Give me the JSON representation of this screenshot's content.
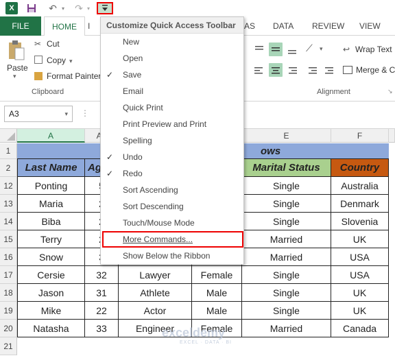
{
  "qat": {
    "excel_logo": "X",
    "undo_icon": "↶",
    "redo_icon": "↷",
    "dropdown_icon": "▾"
  },
  "tabs": {
    "file": "FILE",
    "home": "HOME",
    "i_frag": "I",
    "as_frag": "AS",
    "data": "DATA",
    "review": "REVIEW",
    "view": "VIEW"
  },
  "ribbon": {
    "paste": "Paste",
    "cut": "Cut",
    "copy": "Copy",
    "format_painter": "Format Painter",
    "clipboard": "Clipboard",
    "wrap_text": "Wrap Text",
    "merge": "Merge & C",
    "alignment": "Alignment"
  },
  "formula": {
    "namebox": "A3",
    "dots": "⋮"
  },
  "columns": [
    "A",
    "Ag",
    "",
    "",
    "E",
    "F"
  ],
  "rows": [
    "1",
    "2",
    "12",
    "13",
    "14",
    "15",
    "16",
    "17",
    "18",
    "19",
    "20",
    "21"
  ],
  "title_text": "ows",
  "headers": {
    "a": "Last Name",
    "b": "Ag",
    "e": "Marital Status",
    "f": "Country"
  },
  "table": [
    [
      "Ponting",
      "5",
      "",
      "",
      "Single",
      "Australia"
    ],
    [
      "Maria",
      "2",
      "",
      "",
      "Single",
      "Denmark"
    ],
    [
      "Biba",
      "2",
      "",
      "",
      "Single",
      "Slovenia"
    ],
    [
      "Terry",
      "2",
      "",
      "",
      "Married",
      "UK"
    ],
    [
      "Snow",
      "3",
      "",
      "",
      "Married",
      "USA"
    ],
    [
      "Cersie",
      "32",
      "Lawyer",
      "Female",
      "Single",
      "USA"
    ],
    [
      "Jason",
      "31",
      "Athlete",
      "Male",
      "Single",
      "UK"
    ],
    [
      "Mike",
      "22",
      "Actor",
      "Male",
      "Single",
      "UK"
    ],
    [
      "Natasha",
      "33",
      "Engineer",
      "Female",
      "Married",
      "Canada"
    ]
  ],
  "menu": {
    "title": "Customize Quick Access Toolbar",
    "items": [
      {
        "label": "New",
        "checked": false
      },
      {
        "label": "Open",
        "checked": false
      },
      {
        "label": "Save",
        "checked": true
      },
      {
        "label": "Email",
        "checked": false
      },
      {
        "label": "Quick Print",
        "checked": false
      },
      {
        "label": "Print Preview and Print",
        "checked": false
      },
      {
        "label": "Spelling",
        "checked": false
      },
      {
        "label": "Undo",
        "checked": true
      },
      {
        "label": "Redo",
        "checked": true
      },
      {
        "label": "Sort Ascending",
        "checked": false
      },
      {
        "label": "Sort Descending",
        "checked": false
      },
      {
        "label": "Touch/Mouse Mode",
        "checked": false
      }
    ],
    "more_commands": "More Commands...",
    "show_below": "Show Below the Ribbon",
    "check_glyph": "✓"
  },
  "watermark": {
    "name": "exceldemy",
    "sub": "EXCEL · DATA · BI"
  },
  "colors": {
    "excel_green": "#217346",
    "title_band": "#8ea9db",
    "marital_header": "#a9d08e",
    "country_header": "#c65911",
    "last_name_header": "#8ea9db",
    "highlight_red": "#ee0000"
  }
}
